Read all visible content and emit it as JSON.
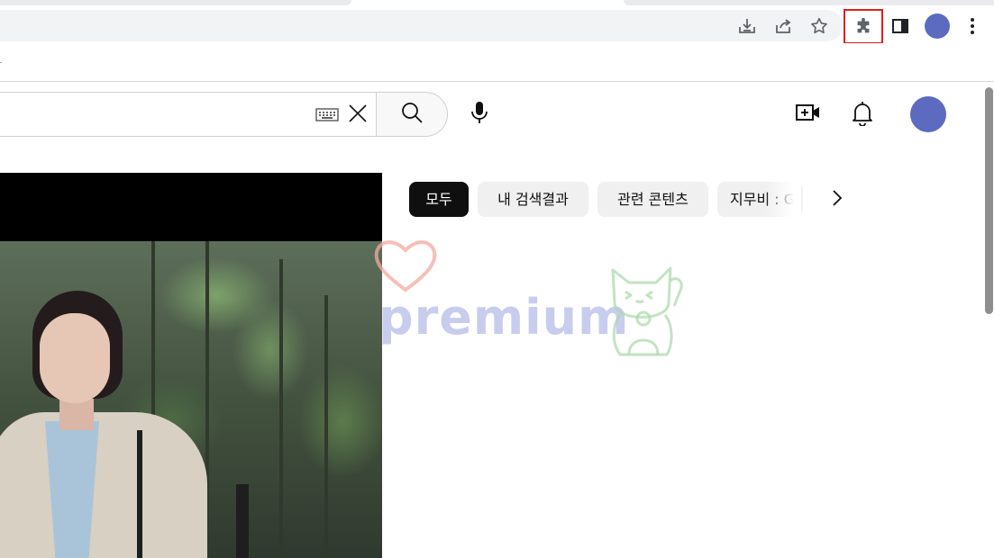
{
  "browser": {
    "toolbar_icons": [
      "download-icon",
      "share-icon",
      "star-icon",
      "extensions-icon",
      "side-panel-icon",
      "profile-avatar",
      "more-vert-icon"
    ],
    "highlight_color": "#e31c1c",
    "profile_color": "#5c6bc0"
  },
  "header": {
    "search": {
      "value": ""
    },
    "icons": [
      "keyboard-icon",
      "clear-icon",
      "search-icon",
      "mic-icon",
      "create-video-icon",
      "bell-icon",
      "avatar"
    ]
  },
  "chips": {
    "items": [
      {
        "label": "모두",
        "active": true
      },
      {
        "label": "내 검색결과",
        "active": false
      },
      {
        "label": "관련 콘텐츠",
        "active": false
      },
      {
        "label": "지무비 : G",
        "active": false
      }
    ],
    "next_icon": "chevron-right-icon"
  },
  "watermark": {
    "text": "premium"
  }
}
